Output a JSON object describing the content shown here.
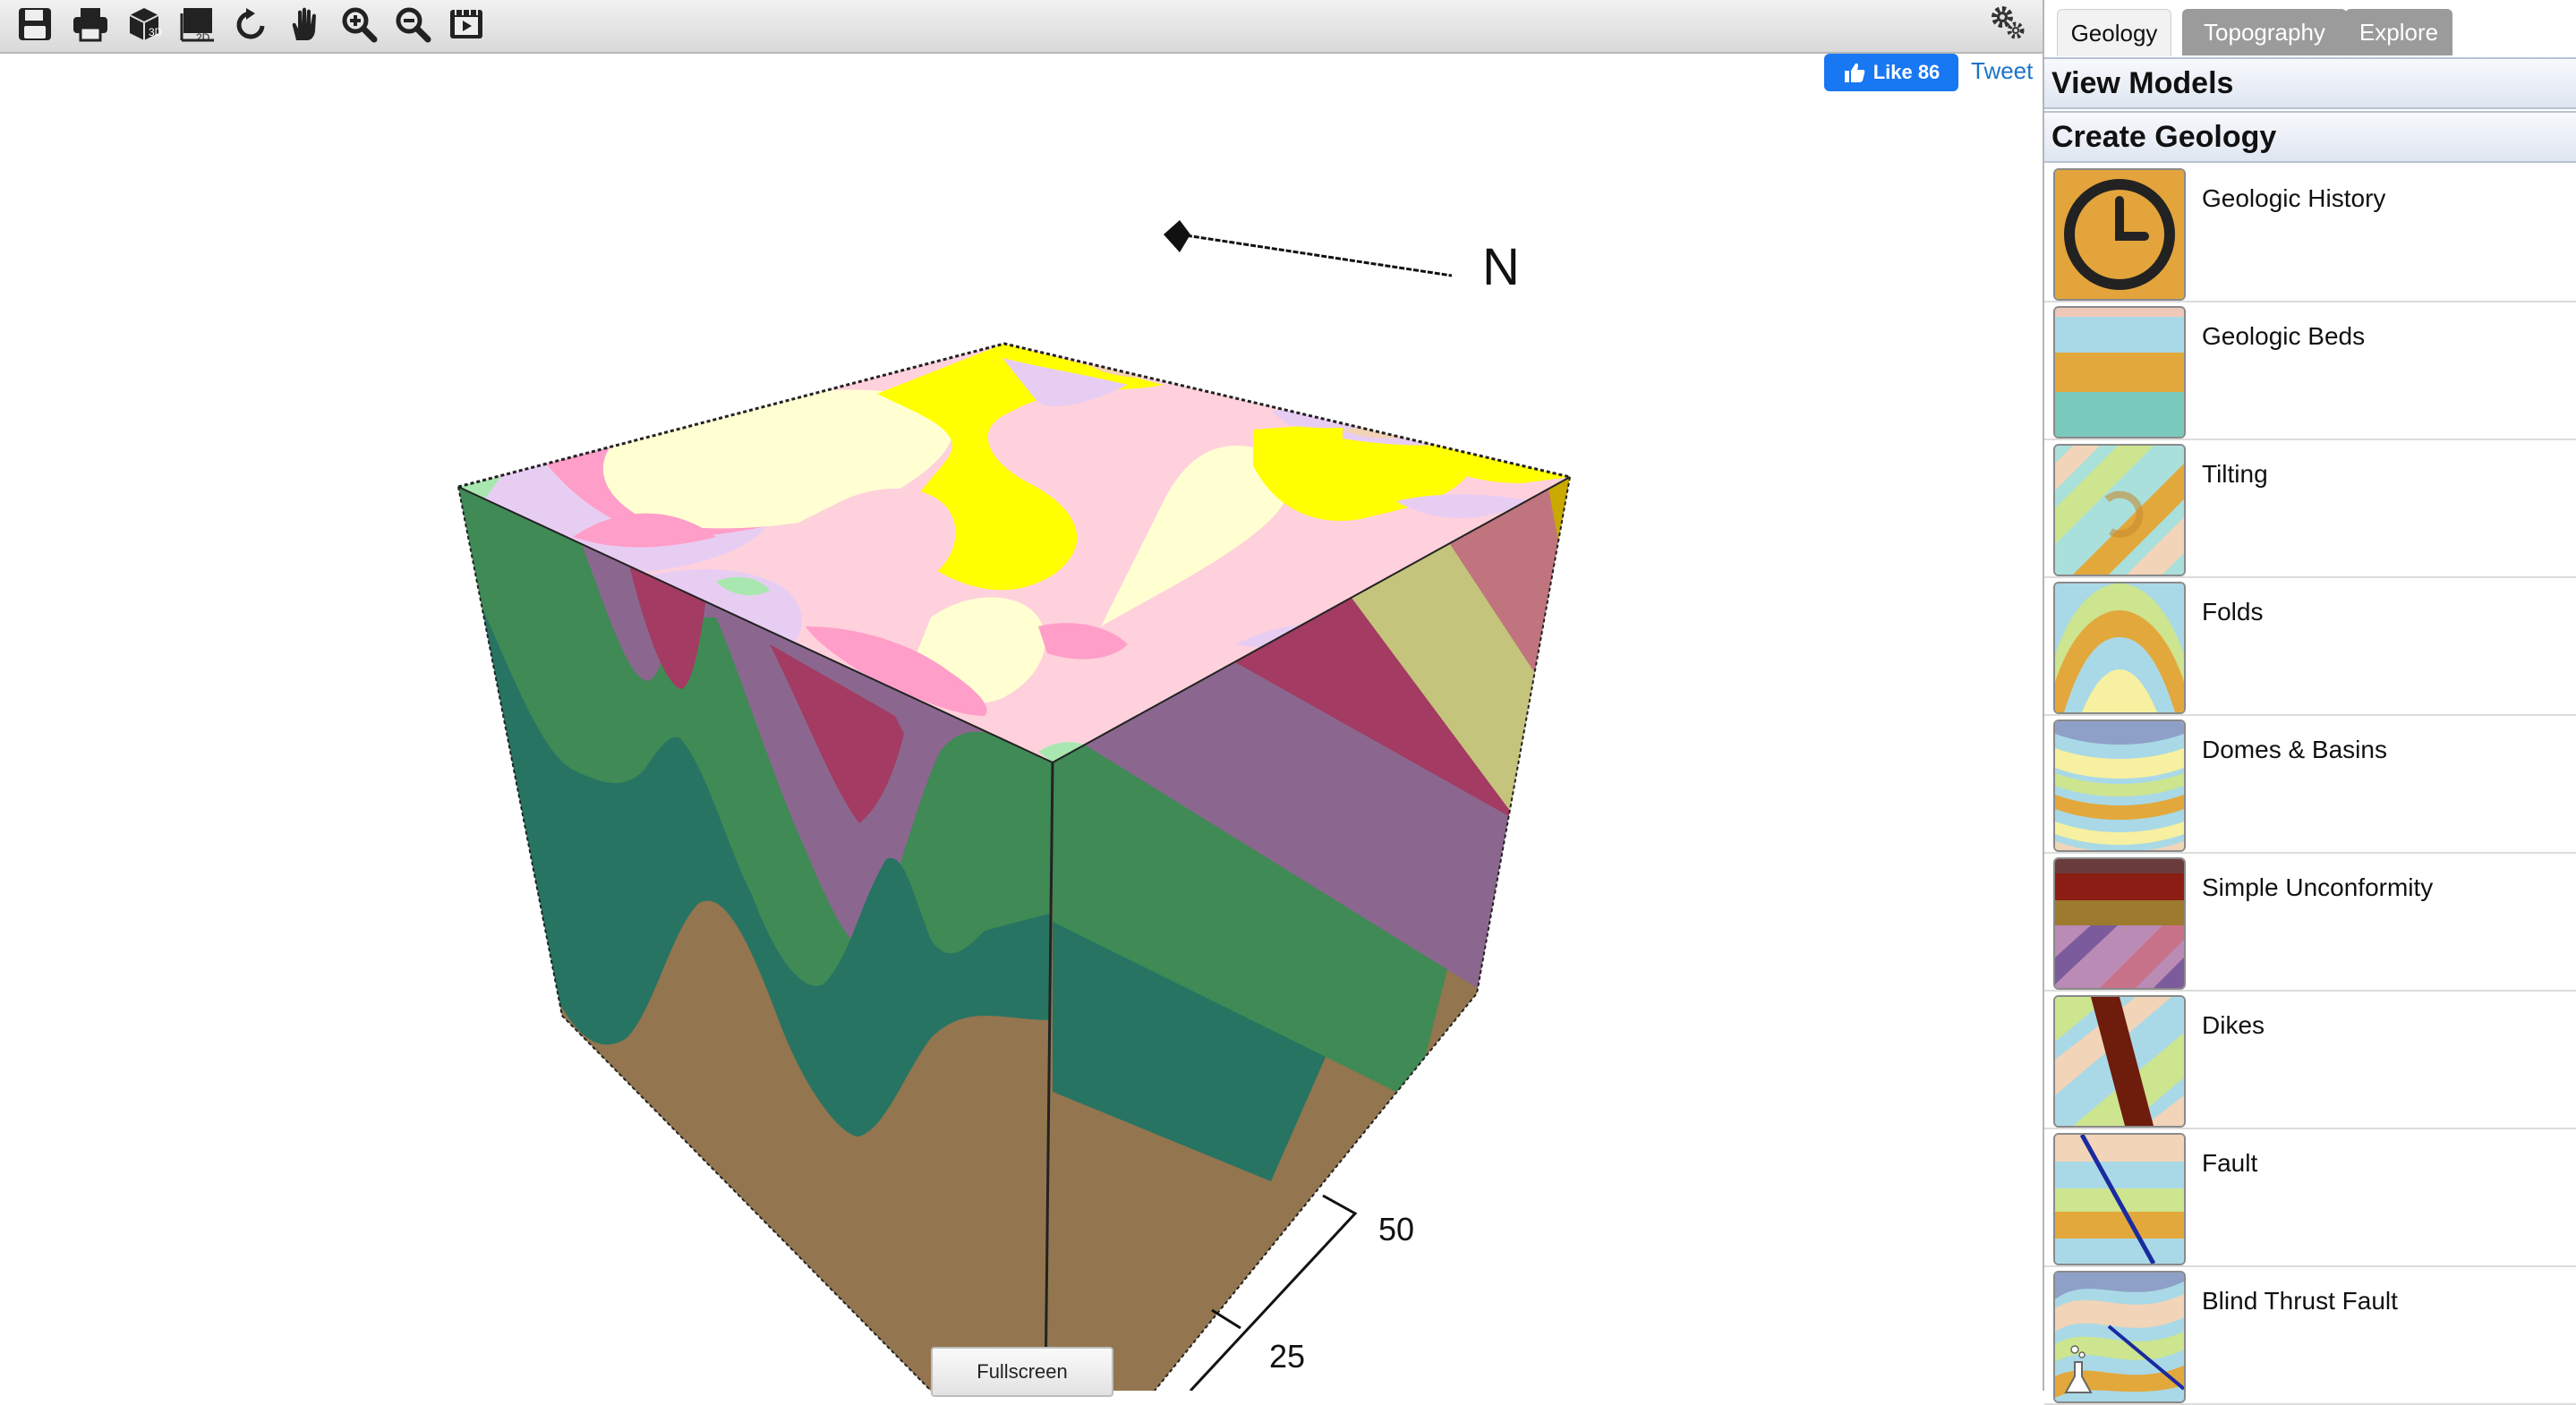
{
  "toolbar": {
    "buttons": [
      {
        "name": "save-icon"
      },
      {
        "name": "print-icon"
      },
      {
        "name": "view-3d-icon",
        "label": "3D"
      },
      {
        "name": "view-2d-icon",
        "label": "2D"
      },
      {
        "name": "reset-rotate-icon"
      },
      {
        "name": "pan-hand-icon"
      },
      {
        "name": "zoom-in-icon"
      },
      {
        "name": "zoom-out-icon"
      },
      {
        "name": "animation-icon"
      }
    ],
    "settings_icon": "gears-icon"
  },
  "social": {
    "like_label": "Like 86",
    "tweet_label": "Tweet"
  },
  "scene": {
    "north_label": "N",
    "scale_labels": [
      "50",
      "25"
    ],
    "fullscreen_label": "Fullscreen"
  },
  "tabs": [
    {
      "label": "Geology",
      "active": true
    },
    {
      "label": "Topography",
      "active": false
    },
    {
      "label": "Explore",
      "active": false
    }
  ],
  "sections": {
    "view_models": "View Models",
    "create_geology": "Create Geology"
  },
  "items": [
    {
      "label": "Geologic History",
      "icon": "clock-icon"
    },
    {
      "label": "Geologic Beds",
      "icon": "beds-icon"
    },
    {
      "label": "Tilting",
      "icon": "tilting-icon"
    },
    {
      "label": "Folds",
      "icon": "folds-icon"
    },
    {
      "label": "Domes & Basins",
      "icon": "domes-basins-icon"
    },
    {
      "label": "Simple Unconformity",
      "icon": "unconformity-icon"
    },
    {
      "label": "Dikes",
      "icon": "dikes-icon"
    },
    {
      "label": "Fault",
      "icon": "fault-icon"
    },
    {
      "label": "Blind Thrust Fault",
      "icon": "blind-thrust-fault-icon"
    }
  ],
  "colors": {
    "brown": "#93754f",
    "dark_green": "#277463",
    "green": "#3f8a55",
    "purple": "#8b678f",
    "crimson": "#a33b62",
    "olive": "#c5c47c",
    "rose": "#c0747e",
    "gold": "#c9a900",
    "pink": "#ff9ec8",
    "light_pink": "#ffd1dc",
    "cream": "#ffffd2",
    "yellow": "#ffff00",
    "lavender": "#e8cdf3",
    "mint": "#a8e8b0",
    "peach": "#f3d3b5",
    "facebook_blue": "#1877f2"
  }
}
